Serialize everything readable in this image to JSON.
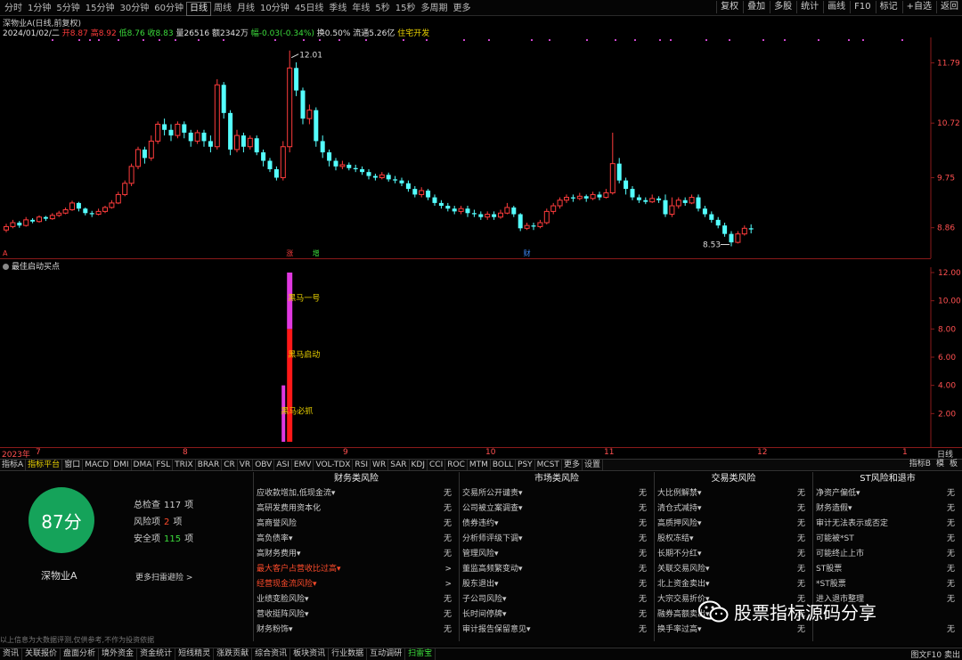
{
  "topbar": {
    "periods": [
      "分时",
      "1分钟",
      "5分钟",
      "15分钟",
      "30分钟",
      "60分钟",
      "日线",
      "周线",
      "月线",
      "10分钟",
      "45日线",
      "季线",
      "年线",
      "5秒",
      "15秒",
      "多周期",
      "更多"
    ],
    "active_period": 6,
    "right_buttons": [
      "复权",
      "叠加",
      "多股",
      "统计",
      "画线",
      "F10",
      "标记",
      "+自选",
      "返回"
    ]
  },
  "info": {
    "stock_label": "深物业A(日线,前复权)",
    "date": "2024/01/02/二",
    "open": "开8.87",
    "high": "高8.92",
    "low": "低8.76",
    "close": "收8.83",
    "volume": "量26516",
    "amount": "额2342万",
    "change": "幅-0.03(-0.34%)",
    "turnover": "换0.50%",
    "float_cap": "流通5.26亿",
    "sector": "住宅开发"
  },
  "colors": {
    "up": "#ff3c3c",
    "down": "#54ffff",
    "axis": "#8a1a1a",
    "magenta": "#e038e0",
    "signal_red": "#ff1818",
    "score_green": "#15a35a"
  },
  "chart_data": {
    "type": "candlestick",
    "price_axis_ticks": [
      11.79,
      10.72,
      9.75,
      8.86
    ],
    "annotations": {
      "high": "12.01",
      "low": "8.53"
    },
    "markers": [
      {
        "label": "A",
        "x_index": 0
      },
      {
        "label": "涨",
        "x_index": 43
      },
      {
        "label": "增",
        "x_index": 47
      },
      {
        "label": "财",
        "x_index": 79
      }
    ],
    "date_ticks": [
      "2023年",
      "7",
      "8",
      "9",
      "10",
      "11",
      "12",
      "1"
    ],
    "candles": [
      [
        8.82,
        8.88,
        8.93,
        8.78
      ],
      [
        8.88,
        8.95,
        9.0,
        8.85
      ],
      [
        8.95,
        8.9,
        8.98,
        8.86
      ],
      [
        8.9,
        9.0,
        9.05,
        8.88
      ],
      [
        9.0,
        8.97,
        9.03,
        8.94
      ],
      [
        8.97,
        9.05,
        9.08,
        8.95
      ],
      [
        9.05,
        9.02,
        9.07,
        8.98
      ],
      [
        9.02,
        9.08,
        9.12,
        9.0
      ],
      [
        9.08,
        9.12,
        9.16,
        9.05
      ],
      [
        9.12,
        9.18,
        9.22,
        9.1
      ],
      [
        9.18,
        9.3,
        9.34,
        9.16
      ],
      [
        9.3,
        9.2,
        9.32,
        9.15
      ],
      [
        9.2,
        9.12,
        9.22,
        9.08
      ],
      [
        9.12,
        9.1,
        9.16,
        9.05
      ],
      [
        9.1,
        9.15,
        9.2,
        9.08
      ],
      [
        9.15,
        9.22,
        9.25,
        9.12
      ],
      [
        9.22,
        9.3,
        9.35,
        9.2
      ],
      [
        9.3,
        9.45,
        9.5,
        9.28
      ],
      [
        9.45,
        9.65,
        9.7,
        9.42
      ],
      [
        9.65,
        9.95,
        10.0,
        9.6
      ],
      [
        9.95,
        10.25,
        10.3,
        9.9
      ],
      [
        10.25,
        10.1,
        10.3,
        10.0
      ],
      [
        10.1,
        10.4,
        10.5,
        10.05
      ],
      [
        10.4,
        10.7,
        10.75,
        10.35
      ],
      [
        10.7,
        10.6,
        10.8,
        10.5
      ],
      [
        10.6,
        10.5,
        10.7,
        10.4
      ],
      [
        10.5,
        10.7,
        10.75,
        10.45
      ],
      [
        10.7,
        10.55,
        10.75,
        10.45
      ],
      [
        10.55,
        10.4,
        10.6,
        10.3
      ],
      [
        10.4,
        10.55,
        10.6,
        10.35
      ],
      [
        10.55,
        10.4,
        10.6,
        10.3
      ],
      [
        10.4,
        10.3,
        10.5,
        10.2
      ],
      [
        10.3,
        11.4,
        11.5,
        10.25
      ],
      [
        11.4,
        10.9,
        11.45,
        10.8
      ],
      [
        10.9,
        10.25,
        10.95,
        10.15
      ],
      [
        10.25,
        10.5,
        10.6,
        10.2
      ],
      [
        10.5,
        10.3,
        10.55,
        10.2
      ],
      [
        10.3,
        10.45,
        10.5,
        10.25
      ],
      [
        10.45,
        10.2,
        10.5,
        10.15
      ],
      [
        10.2,
        10.05,
        10.25,
        9.95
      ],
      [
        10.05,
        9.9,
        10.1,
        9.85
      ],
      [
        9.9,
        9.75,
        9.95,
        9.7
      ],
      [
        9.75,
        10.3,
        10.4,
        9.7
      ],
      [
        10.3,
        11.7,
        12.01,
        10.2
      ],
      [
        11.7,
        11.3,
        11.8,
        11.2
      ],
      [
        11.3,
        10.8,
        11.35,
        10.7
      ],
      [
        10.8,
        10.95,
        11.05,
        10.7
      ],
      [
        10.95,
        10.4,
        11.0,
        10.3
      ],
      [
        10.4,
        10.2,
        10.5,
        10.1
      ],
      [
        10.2,
        10.05,
        10.25,
        9.95
      ],
      [
        10.05,
        9.95,
        10.1,
        9.88
      ],
      [
        9.95,
        9.98,
        10.05,
        9.9
      ],
      [
        9.98,
        9.92,
        10.02,
        9.88
      ],
      [
        9.92,
        9.9,
        9.98,
        9.85
      ],
      [
        9.9,
        9.85,
        9.95,
        9.8
      ],
      [
        9.85,
        9.78,
        9.9,
        9.72
      ],
      [
        9.78,
        9.75,
        9.82,
        9.7
      ],
      [
        9.75,
        9.8,
        9.85,
        9.72
      ],
      [
        9.8,
        9.72,
        9.84,
        9.68
      ],
      [
        9.72,
        9.7,
        9.78,
        9.65
      ],
      [
        9.7,
        9.65,
        9.75,
        9.6
      ],
      [
        9.65,
        9.55,
        9.7,
        9.5
      ],
      [
        9.55,
        9.45,
        9.6,
        9.4
      ],
      [
        9.45,
        9.52,
        9.58,
        9.4
      ],
      [
        9.52,
        9.4,
        9.55,
        9.35
      ],
      [
        9.4,
        9.3,
        9.45,
        9.25
      ],
      [
        9.3,
        9.25,
        9.35,
        9.2
      ],
      [
        9.25,
        9.2,
        9.3,
        9.15
      ],
      [
        9.2,
        9.15,
        9.25,
        9.1
      ],
      [
        9.15,
        9.2,
        9.25,
        9.1
      ],
      [
        9.2,
        9.12,
        9.25,
        9.05
      ],
      [
        9.12,
        9.1,
        9.18,
        9.05
      ],
      [
        9.1,
        9.05,
        9.15,
        9.0
      ],
      [
        9.05,
        9.1,
        9.15,
        9.0
      ],
      [
        9.1,
        9.05,
        9.15,
        9.0
      ],
      [
        9.05,
        9.12,
        9.18,
        9.02
      ],
      [
        9.12,
        9.22,
        9.3,
        9.1
      ],
      [
        9.22,
        9.1,
        9.25,
        9.05
      ],
      [
        9.1,
        8.85,
        9.12,
        8.8
      ],
      [
        8.85,
        8.9,
        8.95,
        8.82
      ],
      [
        8.9,
        8.88,
        8.95,
        8.82
      ],
      [
        8.88,
        8.95,
        9.0,
        8.85
      ],
      [
        8.95,
        9.15,
        9.2,
        8.92
      ],
      [
        9.15,
        9.25,
        9.3,
        9.1
      ],
      [
        9.25,
        9.35,
        9.4,
        9.2
      ],
      [
        9.35,
        9.4,
        9.45,
        9.3
      ],
      [
        9.4,
        9.38,
        9.45,
        9.32
      ],
      [
        9.38,
        9.42,
        9.48,
        9.35
      ],
      [
        9.42,
        9.38,
        9.45,
        9.32
      ],
      [
        9.38,
        9.45,
        9.5,
        9.35
      ],
      [
        9.45,
        9.4,
        9.5,
        9.35
      ],
      [
        9.4,
        9.48,
        9.55,
        9.38
      ],
      [
        9.48,
        10.0,
        10.55,
        9.45
      ],
      [
        10.0,
        9.7,
        10.1,
        9.65
      ],
      [
        9.7,
        9.55,
        9.75,
        9.45
      ],
      [
        9.55,
        9.4,
        9.6,
        9.35
      ],
      [
        9.4,
        9.35,
        9.45,
        9.3
      ],
      [
        9.35,
        9.32,
        9.4,
        9.28
      ],
      [
        9.32,
        9.38,
        9.45,
        9.3
      ],
      [
        9.38,
        9.35,
        9.42,
        9.3
      ],
      [
        9.35,
        9.1,
        9.45,
        9.05
      ],
      [
        9.1,
        9.25,
        9.4,
        9.05
      ],
      [
        9.25,
        9.35,
        9.4,
        9.2
      ],
      [
        9.35,
        9.3,
        9.4,
        9.25
      ],
      [
        9.3,
        9.4,
        9.45,
        9.28
      ],
      [
        9.4,
        9.2,
        9.45,
        9.15
      ],
      [
        9.2,
        9.1,
        9.25,
        9.05
      ],
      [
        9.1,
        9.0,
        9.15,
        8.95
      ],
      [
        9.0,
        8.9,
        9.05,
        8.85
      ],
      [
        8.9,
        8.75,
        8.95,
        8.7
      ],
      [
        8.75,
        8.6,
        8.8,
        8.53
      ],
      [
        8.6,
        8.75,
        8.8,
        8.58
      ],
      [
        8.75,
        8.85,
        8.9,
        8.72
      ],
      [
        8.85,
        8.83,
        8.92,
        8.76
      ]
    ],
    "sub_indicator": {
      "title": "最佳启动买点",
      "y_ticks": [
        "12.00",
        "10.00",
        "8.00",
        "6.00",
        "4.00",
        "2.00"
      ],
      "y_range": [
        0,
        12
      ],
      "bar_labels": [
        "黑马一号",
        "黑马启动",
        "黑马必抓"
      ],
      "bar_x_index": 43,
      "bars": [
        {
          "color": "#e038e0",
          "from": 0,
          "to": 4,
          "offset": -1
        },
        {
          "color": "#ff1818",
          "from": 0,
          "to": 8,
          "offset": 0
        },
        {
          "color": "#e038e0",
          "from": 8,
          "to": 12,
          "offset": 0
        }
      ]
    }
  },
  "tabs": [
    "指标A",
    "指标平台",
    "窗口",
    "MACD",
    "DMI",
    "DMA",
    "FSL",
    "TRIX",
    "BRAR",
    "CR",
    "VR",
    "OBV",
    "ASI",
    "EMV",
    "VOL-TDX",
    "RSI",
    "WR",
    "SAR",
    "KDJ",
    "CCI",
    "ROC",
    "MTM",
    "BOLL",
    "PSY",
    "MCST",
    "更多",
    "设置"
  ],
  "active_tab": 1,
  "tabs_right": [
    "指标B",
    "模",
    "板"
  ],
  "risk": {
    "score": "87分",
    "stock_name": "深物业A",
    "total_label": "总检查",
    "total_value": "117",
    "total_unit": "项",
    "risk_label": "风险项",
    "risk_value": "2",
    "risk_unit": "项",
    "safe_label": "安全项",
    "safe_value": "115",
    "safe_unit": "项",
    "more_label": "更多扫雷避险 >",
    "columns": [
      {
        "title": "财务类风险",
        "items": [
          {
            "label": "应收款增加,低现金流▾",
            "value": "无",
            "alert": false
          },
          {
            "label": "高研发费用资本化",
            "value": "无",
            "alert": false
          },
          {
            "label": "高商誉风险",
            "value": "无",
            "alert": false
          },
          {
            "label": "高负债率▾",
            "value": "无",
            "alert": false
          },
          {
            "label": "高财务费用▾",
            "value": "无",
            "alert": false
          },
          {
            "label": "最大客户占营收比过高▾",
            "value": ">",
            "alert": true
          },
          {
            "label": "经营现金流风险▾",
            "value": ">",
            "alert": true
          },
          {
            "label": "业绩变脸风险▾",
            "value": "无",
            "alert": false
          },
          {
            "label": "营收挺阵风险▾",
            "value": "无",
            "alert": false
          },
          {
            "label": "财务粉饰▾",
            "value": "无",
            "alert": false
          }
        ]
      },
      {
        "title": "市场类风险",
        "items": [
          {
            "label": "交易所公开谴责▾",
            "value": "无",
            "alert": false
          },
          {
            "label": "公司被立案调查▾",
            "value": "无",
            "alert": false
          },
          {
            "label": "债券违约▾",
            "value": "无",
            "alert": false
          },
          {
            "label": "分析师评级下调▾",
            "value": "无",
            "alert": false
          },
          {
            "label": "管理风险▾",
            "value": "无",
            "alert": false
          },
          {
            "label": "董监高频繁变动▾",
            "value": "无",
            "alert": false
          },
          {
            "label": "股东退出▾",
            "value": "无",
            "alert": false
          },
          {
            "label": "子公司风险▾",
            "value": "无",
            "alert": false
          },
          {
            "label": "长时间停牌▾",
            "value": "无",
            "alert": false
          },
          {
            "label": "审计报告保留意见▾",
            "value": "无",
            "alert": false
          }
        ]
      },
      {
        "title": "交易类风险",
        "items": [
          {
            "label": "大比例解禁▾",
            "value": "无",
            "alert": false
          },
          {
            "label": "清仓式减持▾",
            "value": "无",
            "alert": false
          },
          {
            "label": "高质押风险▾",
            "value": "无",
            "alert": false
          },
          {
            "label": "股权冻结▾",
            "value": "无",
            "alert": false
          },
          {
            "label": "长期不分红▾",
            "value": "无",
            "alert": false
          },
          {
            "label": "关联交易风险▾",
            "value": "无",
            "alert": false
          },
          {
            "label": "北上资金卖出▾",
            "value": "无",
            "alert": false
          },
          {
            "label": "大宗交易折价▾",
            "value": "无",
            "alert": false
          },
          {
            "label": "融券高额卖出▾",
            "value": "无",
            "alert": false
          },
          {
            "label": "换手率过高▾",
            "value": "无",
            "alert": false
          }
        ]
      },
      {
        "title": "ST风险和退市",
        "items": [
          {
            "label": "净资产偏低▾",
            "value": "无",
            "alert": false
          },
          {
            "label": "财务造假▾",
            "value": "无",
            "alert": false
          },
          {
            "label": "审计无法表示或否定",
            "value": "无",
            "alert": false
          },
          {
            "label": "可能被*ST",
            "value": "无",
            "alert": false
          },
          {
            "label": "可能终止上市",
            "value": "无",
            "alert": false
          },
          {
            "label": "ST股票",
            "value": "无",
            "alert": false
          },
          {
            "label": "*ST股票",
            "value": "无",
            "alert": false
          },
          {
            "label": "进入退市整理",
            "value": "无",
            "alert": false
          },
          {
            "label": "",
            "value": "",
            "alert": false
          },
          {
            "label": "",
            "value": "无",
            "alert": false
          }
        ]
      }
    ],
    "disclaimer": "以上信息为大数据评测,仅供参考,不作为投资依据"
  },
  "watermark": "股票指标源码分享",
  "bottombar": {
    "items": [
      "资讯",
      "关联报价",
      "盘面分析",
      "境外资金",
      "资金统计",
      "短线精灵",
      "涨跌贡献",
      "综合资讯",
      "板块资讯",
      "行业数据",
      "互动调研",
      "扫雷宝"
    ],
    "active": 11,
    "right": "图文F10   卖出"
  }
}
